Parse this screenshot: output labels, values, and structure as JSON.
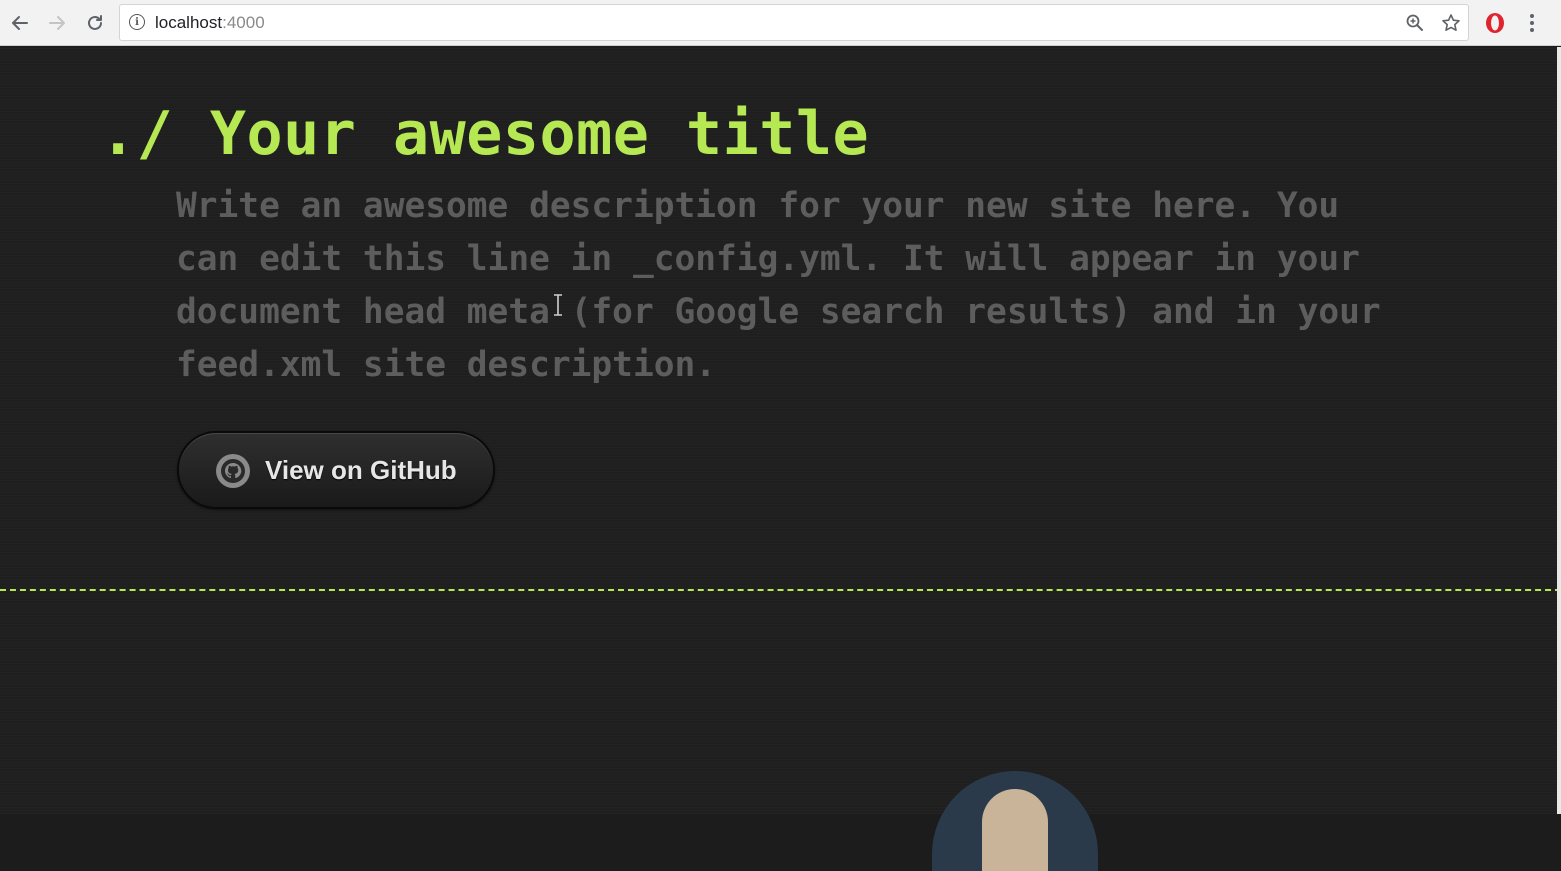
{
  "browser": {
    "url_host": "localhost",
    "url_port": ":4000",
    "icons": {
      "back": "arrow-left-icon",
      "forward": "arrow-right-icon",
      "reload": "reload-icon",
      "info": "info-icon",
      "zoom": "zoom-icon",
      "bookmark": "star-icon",
      "opera": "opera-icon",
      "menu": "kebab-menu-icon"
    }
  },
  "header": {
    "prefix": "./",
    "title": "Your awesome title",
    "description": "Write an awesome description for your new site here. You can edit this line in _config.yml. It will appear in your document head meta (for Google search results) and in your feed.xml site description.",
    "github_button_label": "View on GitHub",
    "github_icon": "github-octocat-icon"
  },
  "colors": {
    "accent": "#b5e853",
    "background": "#1f1f1f",
    "description_text": "#5d5d5d"
  }
}
